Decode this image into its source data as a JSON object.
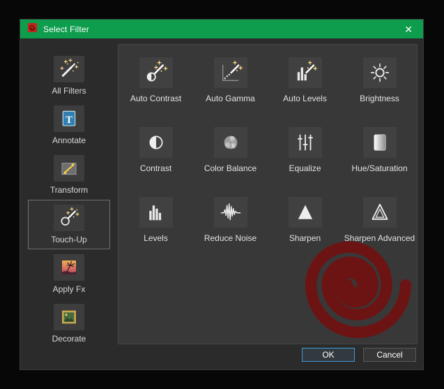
{
  "window": {
    "title": "Select Filter",
    "close_glyph": "✕"
  },
  "sidebar": {
    "items": [
      {
        "label": "All Filters",
        "icon": "magic-wand",
        "selected": false
      },
      {
        "label": "Annotate",
        "icon": "annotate",
        "selected": false
      },
      {
        "label": "Transform",
        "icon": "transform",
        "selected": false
      },
      {
        "label": "Touch-Up",
        "icon": "touch-up",
        "selected": true
      },
      {
        "label": "Apply Fx",
        "icon": "apply-fx",
        "selected": false
      },
      {
        "label": "Decorate",
        "icon": "decorate",
        "selected": false
      }
    ]
  },
  "filters": [
    {
      "label": "Auto Contrast",
      "icon": "auto-contrast"
    },
    {
      "label": "Auto Gamma",
      "icon": "auto-gamma"
    },
    {
      "label": "Auto Levels",
      "icon": "auto-levels"
    },
    {
      "label": "Brightness",
      "icon": "brightness"
    },
    {
      "label": "Contrast",
      "icon": "contrast"
    },
    {
      "label": "Color Balance",
      "icon": "color-balance"
    },
    {
      "label": "Equalize",
      "icon": "equalize"
    },
    {
      "label": "Hue/Saturation",
      "icon": "hue-saturation"
    },
    {
      "label": "Levels",
      "icon": "levels"
    },
    {
      "label": "Reduce Noise",
      "icon": "reduce-noise"
    },
    {
      "label": "Sharpen",
      "icon": "sharpen"
    },
    {
      "label": "Sharpen Advanced",
      "icon": "sharpen-advanced"
    }
  ],
  "buttons": {
    "ok": "OK",
    "cancel": "Cancel"
  },
  "colors": {
    "titlebar_green": "#0d9d4d",
    "ok_border_blue": "#3f9bd8",
    "watermark_red": "#701212"
  }
}
